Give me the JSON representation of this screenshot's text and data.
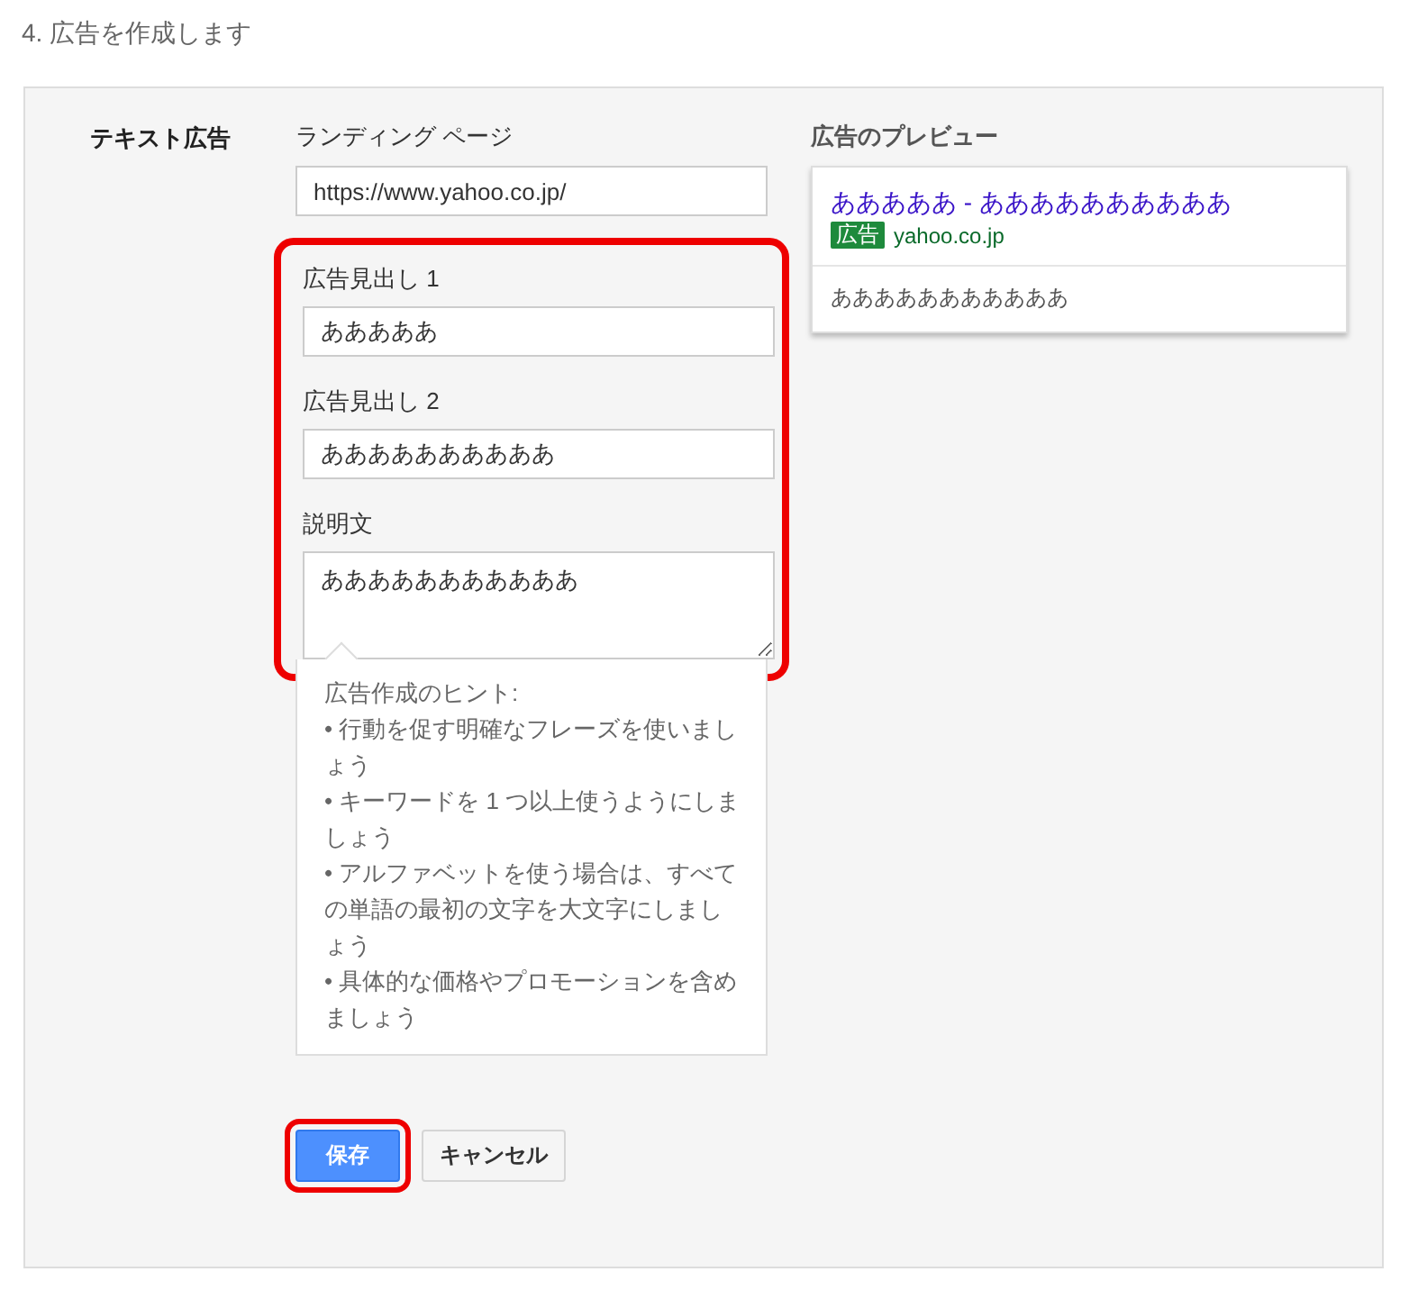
{
  "page_title": "4. 広告を作成します",
  "section_label": "テキスト広告",
  "landing_page": {
    "label": "ランディング ページ",
    "value": "https://www.yahoo.co.jp/"
  },
  "highlight_group": {
    "highlighted": true,
    "fields": [
      {
        "label": "広告見出し 1",
        "value": "あああああ",
        "kind": "input"
      },
      {
        "label": "広告見出し 2",
        "value": "ああああああああああ",
        "kind": "input"
      },
      {
        "label": "説明文",
        "value": "あああああああああああ",
        "kind": "textarea"
      }
    ]
  },
  "hints": {
    "title": "広告作成のヒント:",
    "items": [
      "• 行動を促す明確なフレーズを使いましょう",
      "• キーワードを 1 つ以上使うようにしましょう",
      "• アルファベットを使う場合は、すべての単語の最初の文字を大文字にしましょう",
      "• 具体的な価格やプロモーションを含めましょう"
    ]
  },
  "preview": {
    "title": "広告のプレビュー",
    "headline": "あああああ - ああああああああああ",
    "badge": "広告",
    "url": "yahoo.co.jp",
    "description": "あああああああああああ"
  },
  "buttons": [
    {
      "label": "保存",
      "kind": "primary",
      "highlighted": true
    },
    {
      "label": "キャンセル",
      "kind": "secondary",
      "highlighted": false
    }
  ]
}
